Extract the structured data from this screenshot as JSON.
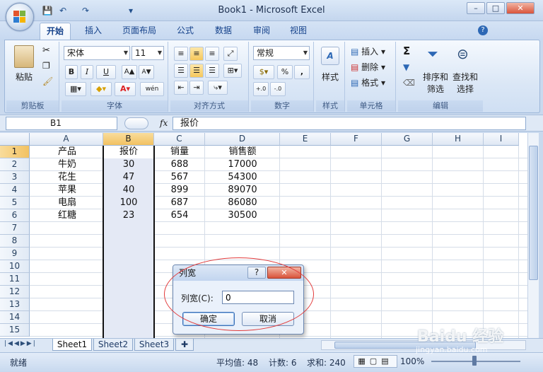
{
  "window": {
    "title": "Book1 - Microsoft Excel",
    "min_glyph": "–",
    "max_glyph": "□",
    "close_glyph": "✕"
  },
  "qat": {
    "save": "💾",
    "undo": "↶",
    "redo": "↷",
    "more": "▾"
  },
  "tabs": [
    "开始",
    "插入",
    "页面布局",
    "公式",
    "数据",
    "审阅",
    "视图"
  ],
  "ribbon": {
    "clipboard": {
      "label": "剪贴板",
      "paste": "粘贴"
    },
    "font": {
      "label": "字体",
      "name": "宋体",
      "size": "11",
      "bold": "B",
      "italic": "I",
      "underline": "U",
      "grow": "A▲",
      "shrink": "A▼",
      "wen": "wén"
    },
    "alignment": {
      "label": "对齐方式"
    },
    "number": {
      "label": "数字",
      "format": "常规",
      "percent": "%",
      "comma": ",",
      "inc": ".0→.00",
      "dec": ".00→.0"
    },
    "styles": {
      "label": "样式"
    },
    "cells": {
      "label": "单元格",
      "insert": "插入",
      "delete": "删除",
      "format": "格式"
    },
    "editing": {
      "label": "编辑",
      "sort": "排序和",
      "sort2": "筛选",
      "find": "查找和",
      "find2": "选择",
      "sigma": "Σ"
    }
  },
  "formula": {
    "namebox": "B1",
    "fx": "fx",
    "content": "报价"
  },
  "columns": [
    "A",
    "B",
    "C",
    "D",
    "E",
    "F",
    "G",
    "H",
    "I"
  ],
  "rows": [
    "1",
    "2",
    "3",
    "4",
    "5",
    "6",
    "7",
    "8",
    "9",
    "10",
    "11",
    "12",
    "13",
    "14",
    "15"
  ],
  "table": [
    [
      "产品",
      "报价",
      "销量",
      "销售额"
    ],
    [
      "牛奶",
      "30",
      "688",
      "17000"
    ],
    [
      "花生",
      "47",
      "567",
      "54300"
    ],
    [
      "苹果",
      "40",
      "899",
      "89070"
    ],
    [
      "电扇",
      "100",
      "687",
      "86080"
    ],
    [
      "红糖",
      "23",
      "654",
      "30500"
    ]
  ],
  "sheets": [
    "Sheet1",
    "Sheet2",
    "Sheet3"
  ],
  "status": {
    "ready": "就绪",
    "average": "平均值: 48",
    "count": "计数: 6",
    "sum": "求和: 240",
    "zoom": "100%"
  },
  "dialog": {
    "title": "列宽",
    "help": "?",
    "close": "✕",
    "field_label": "列宽(C):",
    "field_value": "0",
    "ok": "确定",
    "cancel": "取消"
  },
  "watermark": {
    "brand": "Baidu 经验",
    "url": "jingyan.baidu.com"
  },
  "colors": {
    "selection": "#f2c262",
    "accent": "#15428b",
    "annotation": "#e23b3b"
  }
}
